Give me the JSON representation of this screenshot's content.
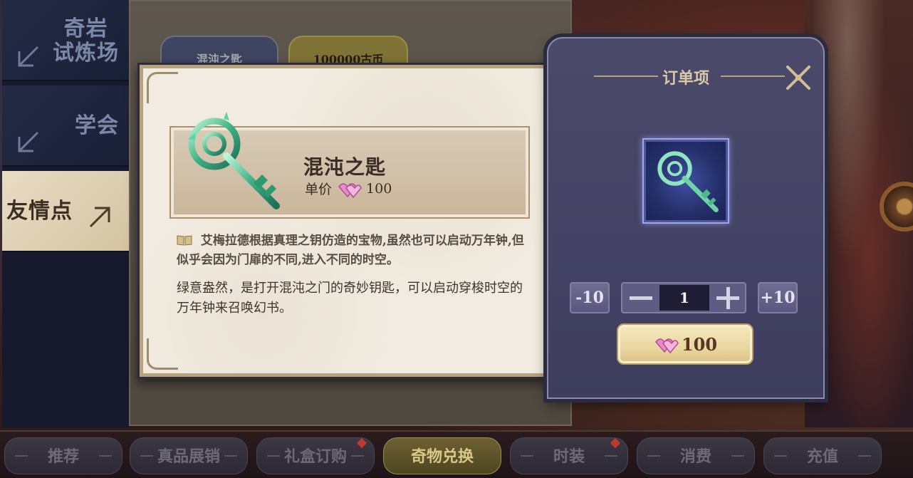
{
  "left_nav": {
    "items": [
      {
        "label": "奇岩\n试炼场"
      },
      {
        "label": "学会"
      },
      {
        "label": "友情点",
        "active": true
      }
    ]
  },
  "shop": {
    "tags": [
      {
        "label": "混沌之匙"
      },
      {
        "label": "100000古币"
      }
    ]
  },
  "item_detail": {
    "name": "混沌之匙",
    "unit_price_label": "单价",
    "unit_price": "100",
    "description_primary": "艾梅拉德根据真理之钥仿造的宝物,虽然也可以启动万年钟,但似乎会因为门扉的不同,进入不同的时空。",
    "description_secondary": "绿意盎然，是打开混沌之门的奇妙钥匙，可以启动穿梭时空的万年钟来召唤幻书。"
  },
  "order_panel": {
    "title": "订单项",
    "minus_ten_label": "-10",
    "plus_ten_label": "+10",
    "quantity": "1",
    "total_price": "100"
  },
  "bottom_tabs": [
    {
      "label": "推荐"
    },
    {
      "label": "真品展销"
    },
    {
      "label": "礼盒订购",
      "badge": true
    },
    {
      "label": "奇物兑换",
      "active": true
    },
    {
      "label": "时装",
      "badge": true
    },
    {
      "label": "消费"
    },
    {
      "label": "充值"
    }
  ],
  "colors": {
    "accent_gold": "#d9c88a",
    "panel_purple": "#434264",
    "card_paper": "#f1ebe1",
    "gem_pink": "#e88ac8"
  }
}
